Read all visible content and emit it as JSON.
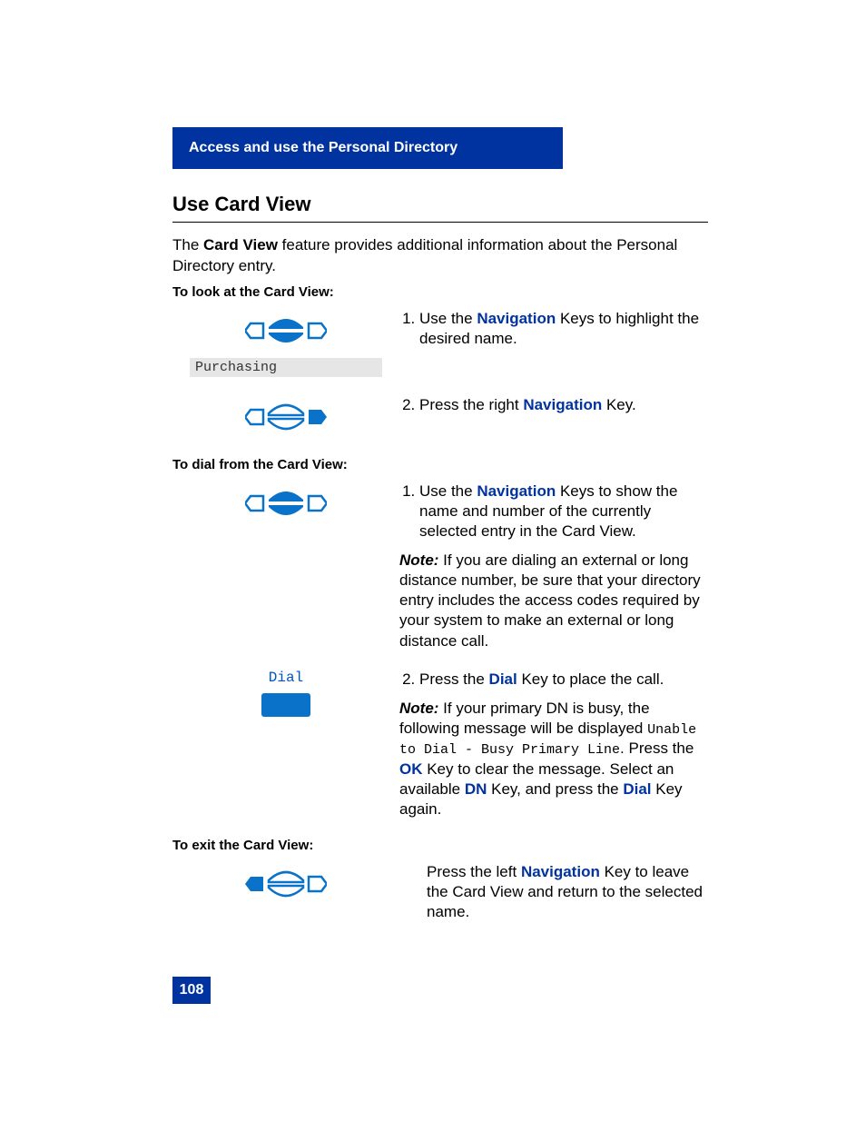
{
  "header": "Access and use the Personal Directory",
  "title": "Use Card View",
  "intro_pre": "The ",
  "intro_bold": "Card View",
  "intro_post": " feature provides additional information about the Personal Directory entry.",
  "sub1": "To look at the Card View:",
  "display_text": "Purchasing",
  "step1_1_a": "Use the ",
  "step1_1_kw": "Navigation",
  "step1_1_b": " Keys to highlight the desired name.",
  "step1_2_a": "Press the right ",
  "step1_2_kw": "Navigation",
  "step1_2_b": " Key.",
  "sub2": "To dial from the Card View:",
  "step2_1_a": "Use the ",
  "step2_1_kw": "Navigation",
  "step2_1_b": " Keys to show the name and number of the currently selected entry in the Card View.",
  "note1_label": "Note:",
  "note1_text": "  If you are dialing an external or long distance number, be sure that your directory entry includes the access codes required by your system to make an external or long distance call.",
  "dial_label": "Dial",
  "step2_2_a": "Press the ",
  "step2_2_kw": "Dial",
  "step2_2_b": " Key to place the call.",
  "note2_label": "Note:",
  "note2_a": " If your primary DN is busy, the following message will be displayed ",
  "note2_mono": "Unable to Dial - Busy Primary Line",
  "note2_b": ". Press the ",
  "note2_kw1": "OK",
  "note2_c": " Key to clear the message. Select an available ",
  "note2_kw2": "DN",
  "note2_d": " Key, and press the ",
  "note2_kw3": "Dial",
  "note2_e": " Key again.",
  "sub3": "To exit the Card View:",
  "exit_a": "Press the left ",
  "exit_kw": "Navigation",
  "exit_b": " Key to leave the Card View and return to the selected name.",
  "page_number": "108"
}
